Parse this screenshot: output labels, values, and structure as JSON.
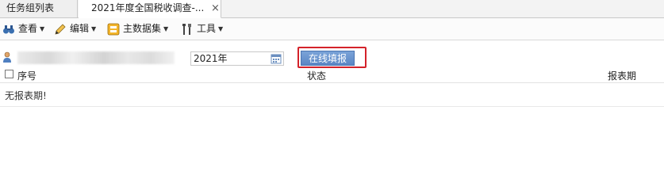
{
  "tabs": [
    {
      "label": "任务组列表"
    },
    {
      "label": "2021年度全国税收调查-...",
      "close": "×"
    }
  ],
  "toolbar": {
    "view_label": "查看",
    "edit_label": "编辑",
    "master_label": "主数据集",
    "tools_label": "工具"
  },
  "filter": {
    "year_value": "2021年",
    "online_button": "在线填报"
  },
  "table": {
    "columns": [
      "序号",
      "状态",
      "报表期"
    ],
    "empty_text": "无报表期!"
  },
  "colors": {
    "highlight": "#d4222a",
    "button": "#5a86c4"
  }
}
